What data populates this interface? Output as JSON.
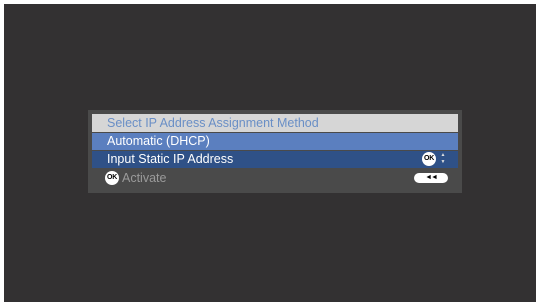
{
  "menu": {
    "title": "Select IP Address Assignment Method",
    "options": [
      {
        "label": "Automatic (DHCP)",
        "state": "highlighted"
      },
      {
        "label": "Input Static IP Address",
        "state": "selected"
      }
    ]
  },
  "footer": {
    "activate_label": "Activate",
    "ok_button_text": "OK",
    "back_button_icon": "rewind-back-icon",
    "back_button_glyph": "◄◄"
  },
  "icons": {
    "ok": "ok-button-icon",
    "updown": "up-down-arrows-icon",
    "updown_glyph_up": "▲",
    "updown_glyph_down": "▼"
  },
  "colors": {
    "screen_background": "#333132",
    "panel_background": "#4a4a4a",
    "title_background": "#d6d6d6",
    "title_text": "#6a8fc6",
    "highlight_option": "#5b7fbf",
    "selected_option": "#2f5187",
    "activate_text": "#9a9a9a"
  }
}
